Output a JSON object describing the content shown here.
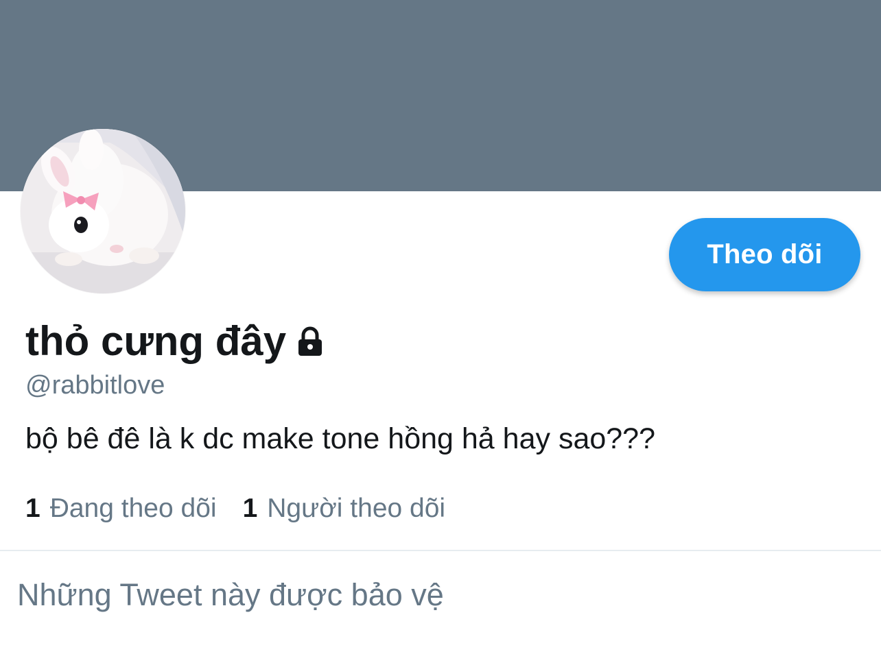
{
  "profile": {
    "display_name": "thỏ cưng đây",
    "handle": "@rabbitlove",
    "bio": "bộ bê đê là k dc make tone hồng hả hay sao???",
    "avatar_icon": "rabbit-photo",
    "protected_icon": "lock-icon",
    "banner_color": "#657786"
  },
  "actions": {
    "follow_label": "Theo dõi",
    "follow_color": "#2497ed"
  },
  "stats": {
    "following_count": "1",
    "following_label": "Đang theo dõi",
    "followers_count": "1",
    "followers_label": "Người theo dõi"
  },
  "tweets": {
    "protected_message": "Những Tweet này được bảo vệ"
  }
}
